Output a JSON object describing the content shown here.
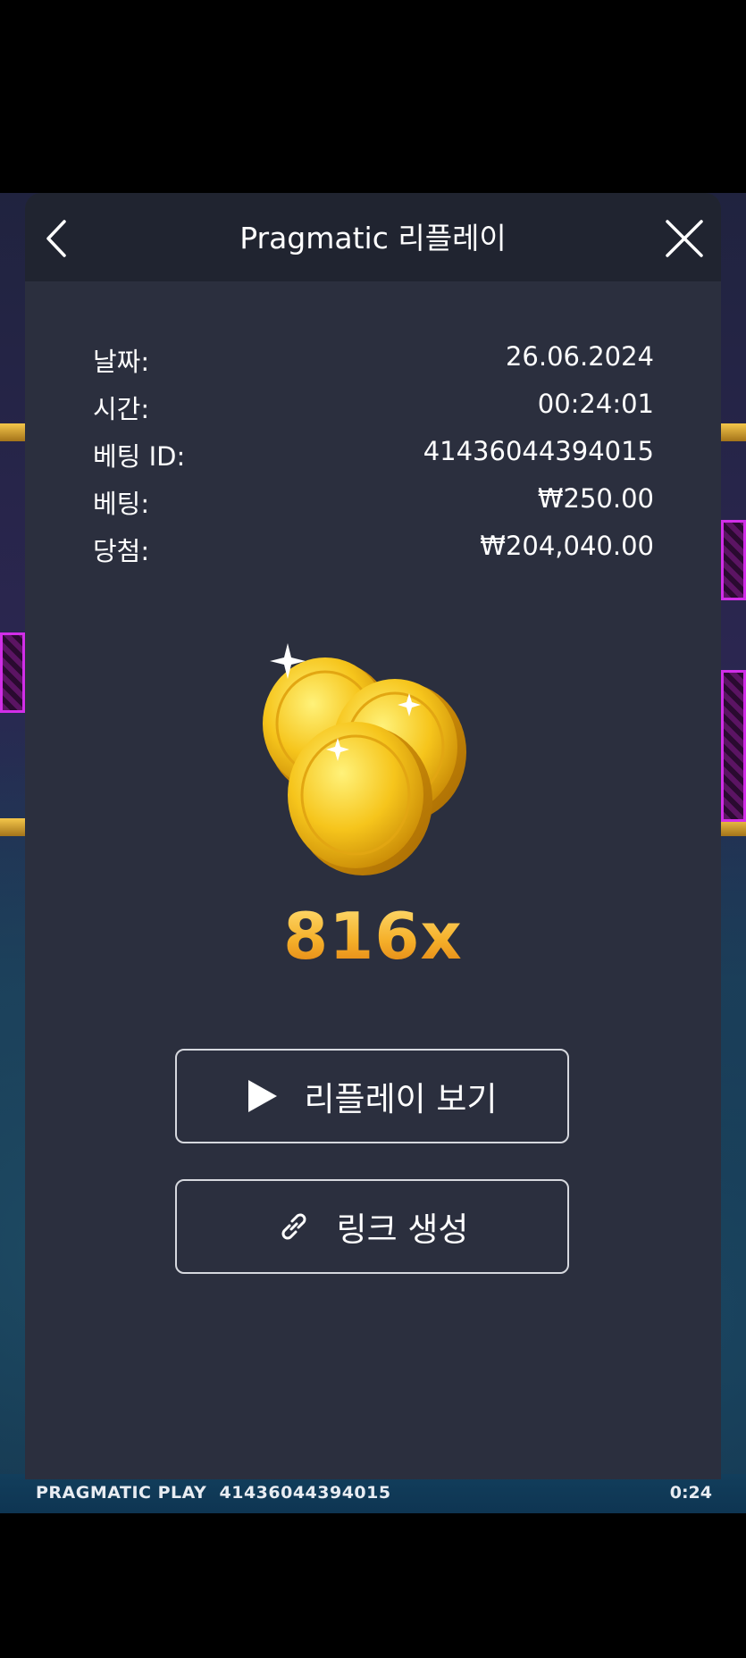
{
  "modal": {
    "title": "Pragmatic 리플레이",
    "back_icon": "chevron-left-icon",
    "close_icon": "close-icon"
  },
  "info": [
    {
      "label": "날짜:",
      "value": "26.06.2024"
    },
    {
      "label": "시간:",
      "value": "00:24:01"
    },
    {
      "label": "베팅 ID:",
      "value": "41436044394015"
    },
    {
      "label": "베팅:",
      "value": "₩250.00"
    },
    {
      "label": "당첨:",
      "value": "₩204,040.00"
    }
  ],
  "win": {
    "multiplier": "816x",
    "image": "gold-coins"
  },
  "buttons": {
    "replay_label": "리플레이 보기",
    "replay_icon": "play-icon",
    "link_label": "링크 생성",
    "link_icon": "link-icon"
  },
  "game_footer": {
    "brand": "PRAGMATIC PLAY",
    "bet_id": "41436044394015",
    "time": "0:24"
  },
  "colors": {
    "modal_bg": "#2b2f3e",
    "header_bg": "#202430",
    "multiplier_gold": "#f6b52a"
  }
}
